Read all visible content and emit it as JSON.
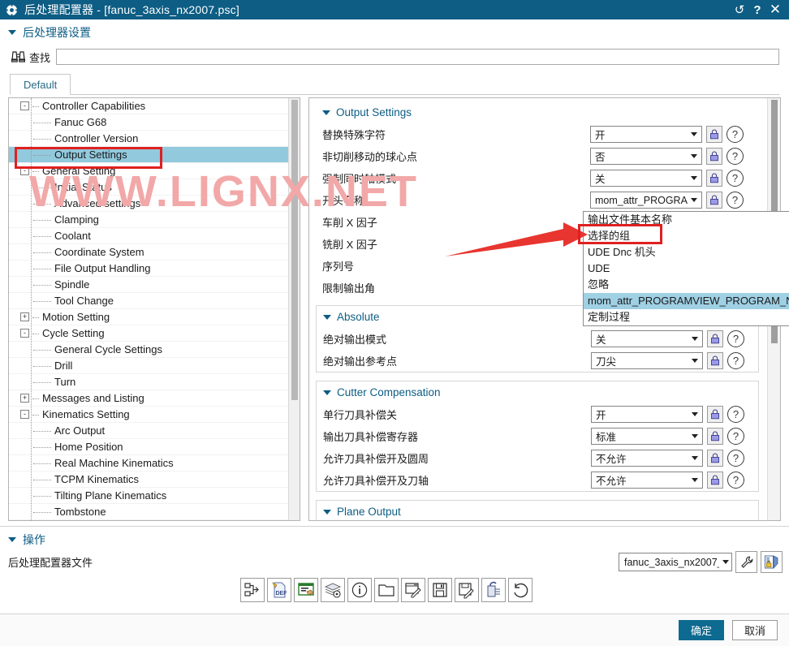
{
  "titlebar": {
    "icon": "gear-icon",
    "title": "后处理配置器 - [fanuc_3axis_nx2007.psc]",
    "buttons": [
      {
        "name": "refresh-icon",
        "glyph": "↺"
      },
      {
        "name": "help-icon",
        "glyph": "?"
      },
      {
        "name": "close-icon",
        "glyph": "✕"
      }
    ]
  },
  "section": {
    "header": "后处理器设置"
  },
  "find": {
    "icon": "binoculars-icon",
    "label": "查找",
    "value": "",
    "placeholder": ""
  },
  "tabs": [
    {
      "label": "Default",
      "active": true
    }
  ],
  "tree": {
    "items": [
      {
        "label": "Controller Capabilities",
        "level": 1,
        "expander": "-"
      },
      {
        "label": "Fanuc G68",
        "level": 2,
        "expander": ""
      },
      {
        "label": "Controller Version",
        "level": 2,
        "expander": ""
      },
      {
        "label": "Output Settings",
        "level": 2,
        "expander": "",
        "selected": true
      },
      {
        "label": "General Setting",
        "level": 1,
        "expander": "-"
      },
      {
        "label": "Initial Status",
        "level": 2,
        "expander": ""
      },
      {
        "label": "Advanced settings",
        "level": 2,
        "expander": ""
      },
      {
        "label": "Clamping",
        "level": 2,
        "expander": ""
      },
      {
        "label": "Coolant",
        "level": 2,
        "expander": ""
      },
      {
        "label": "Coordinate System",
        "level": 2,
        "expander": ""
      },
      {
        "label": "File Output Handling",
        "level": 2,
        "expander": ""
      },
      {
        "label": "Spindle",
        "level": 2,
        "expander": ""
      },
      {
        "label": "Tool Change",
        "level": 2,
        "expander": ""
      },
      {
        "label": "Motion Setting",
        "level": 1,
        "expander": "+"
      },
      {
        "label": "Cycle Setting",
        "level": 1,
        "expander": "-"
      },
      {
        "label": "General Cycle Settings",
        "level": 2,
        "expander": ""
      },
      {
        "label": "Drill",
        "level": 2,
        "expander": ""
      },
      {
        "label": "Turn",
        "level": 2,
        "expander": ""
      },
      {
        "label": "Messages and Listing",
        "level": 1,
        "expander": "+"
      },
      {
        "label": "Kinematics Setting",
        "level": 1,
        "expander": "-"
      },
      {
        "label": "Arc Output",
        "level": 2,
        "expander": ""
      },
      {
        "label": "Home Position",
        "level": 2,
        "expander": ""
      },
      {
        "label": "Real Machine Kinematics",
        "level": 2,
        "expander": ""
      },
      {
        "label": "TCPM Kinematics",
        "level": 2,
        "expander": ""
      },
      {
        "label": "Tilting Plane Kinematics",
        "level": 2,
        "expander": ""
      },
      {
        "label": "Tombstone",
        "level": 2,
        "expander": ""
      }
    ]
  },
  "panel": {
    "groups": [
      {
        "title": "Output Settings",
        "rows": [
          {
            "label": "替换特殊字符",
            "value": "开"
          },
          {
            "label": "非切削移动的球心点",
            "value": "否"
          },
          {
            "label": "强制同时轴模式",
            "value": "关"
          },
          {
            "label": "开头名称",
            "value": "mom_attr_PROGRAM"
          },
          {
            "label": "车削 X 因子",
            "value": ""
          },
          {
            "label": "铣削 X 因子",
            "value": ""
          },
          {
            "label": "序列号",
            "value": ""
          },
          {
            "label": "限制输出角",
            "value": ""
          }
        ]
      },
      {
        "title": "Absolute",
        "rows": [
          {
            "label": "绝对输出模式",
            "value": "关"
          },
          {
            "label": "绝对输出参考点",
            "value": "刀尖"
          }
        ]
      },
      {
        "title": "Cutter Compensation",
        "rows": [
          {
            "label": "单行刀具补偿关",
            "value": "开"
          },
          {
            "label": "输出刀具补偿寄存器",
            "value": "标准"
          },
          {
            "label": "允许刀具补偿开及圆周",
            "value": "不允许"
          },
          {
            "label": "允许刀具补偿开及刀轴",
            "value": "不允许"
          }
        ]
      },
      {
        "title": "Plane Output",
        "rows": []
      }
    ]
  },
  "dropdown": {
    "items": [
      {
        "label": "输出文件基本名称",
        "highlight": false
      },
      {
        "label": "选择的组",
        "highlight": false,
        "boxed": true
      },
      {
        "label": "UDE Dnc 机头",
        "highlight": false
      },
      {
        "label": "UDE",
        "highlight": false
      },
      {
        "label": "忽略",
        "highlight": false
      },
      {
        "label": "mom_attr_PROGRAMVIEW_PROGRAM_NU",
        "highlight": true
      },
      {
        "label": "定制过程",
        "highlight": false
      }
    ]
  },
  "watermark": {
    "text": "WWW.LIGNX.NET",
    "color": "#f2a8a8"
  },
  "operations": {
    "header": "操作",
    "subtitle": "后处理配置器文件",
    "file_select": {
      "value": "fanuc_3axis_nx2007_"
    },
    "side_buttons": [
      {
        "name": "wrench-icon"
      },
      {
        "name": "secure-document-icon"
      }
    ],
    "toolbar_icons": [
      {
        "name": "flowchart-export-icon"
      },
      {
        "name": "def-file-icon"
      },
      {
        "name": "window-edit-icon"
      },
      {
        "name": "layers-settings-icon"
      },
      {
        "name": "info-icon"
      },
      {
        "name": "open-folder-icon"
      },
      {
        "name": "window-new-icon"
      },
      {
        "name": "save-icon"
      },
      {
        "name": "save-as-icon"
      },
      {
        "name": "copy-paste-icon"
      },
      {
        "name": "undo-icon"
      }
    ]
  },
  "footer": {
    "ok_label": "确定",
    "cancel_label": "取消",
    "ok_color": "#0d6a90"
  },
  "colors": {
    "titlebar": "#0d5d84",
    "accent": "#0d5d84",
    "selection": "#92c9dd",
    "annotation_red": "#e02020"
  }
}
